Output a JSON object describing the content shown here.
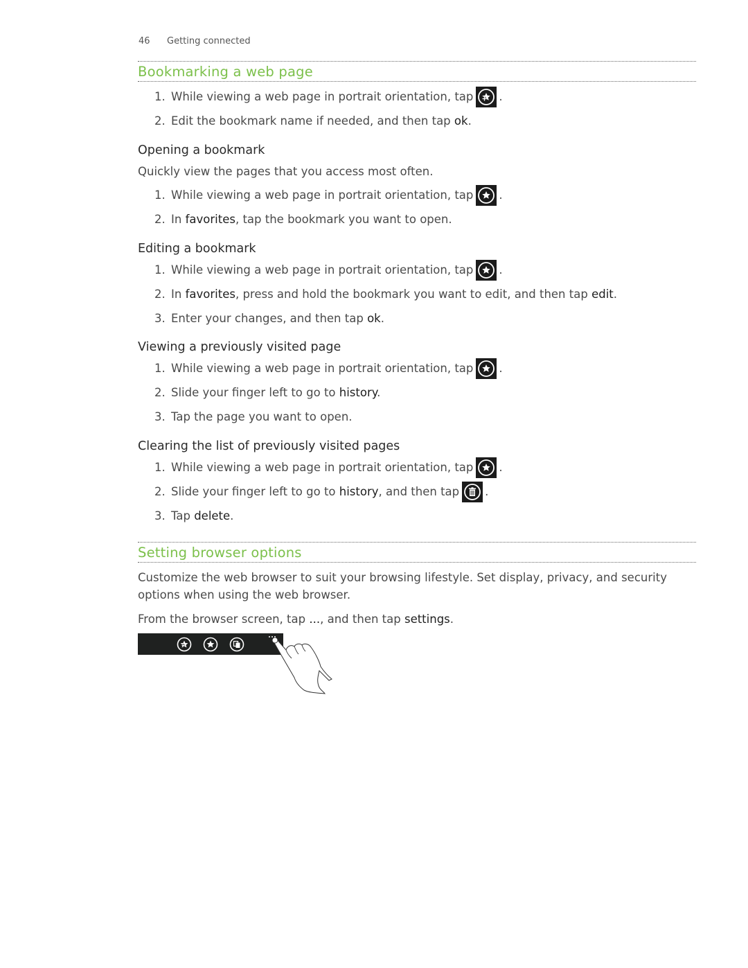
{
  "header": {
    "page_number": "46",
    "chapter": "Getting connected"
  },
  "sections": {
    "bookmarking": {
      "title": "Bookmarking a web page",
      "steps": [
        {
          "num": "1.",
          "text": "While viewing a web page in portrait orientation, tap",
          "icon": "add-favorite-icon",
          "after": "."
        },
        {
          "num": "2.",
          "pre": "Edit the bookmark name if needed, and then tap ",
          "kw": "ok",
          "after": "."
        }
      ]
    },
    "opening": {
      "title": "Opening a bookmark",
      "intro": "Quickly view the pages that you access most often.",
      "steps": [
        {
          "num": "1.",
          "text": "While viewing a web page in portrait orientation, tap",
          "icon": "favorites-icon",
          "after": "."
        },
        {
          "num": "2.",
          "pre": "In ",
          "kw": "favorites",
          "post": ", tap the bookmark you want to open."
        }
      ]
    },
    "editing": {
      "title": "Editing a bookmark",
      "steps": [
        {
          "num": "1.",
          "text": "While viewing a web page in portrait orientation, tap",
          "icon": "favorites-icon",
          "after": "."
        },
        {
          "num": "2.",
          "pre": "In ",
          "kw": "favorites",
          "mid": ", press and hold the bookmark you want to edit, and then tap ",
          "kw2": "edit",
          "after": "."
        },
        {
          "num": "3.",
          "pre": "Enter your changes, and then tap ",
          "kw": "ok",
          "after": "."
        }
      ]
    },
    "viewing": {
      "title": "Viewing a previously visited page",
      "steps": [
        {
          "num": "1.",
          "text": "While viewing a web page in portrait orientation, tap",
          "icon": "favorites-icon",
          "after": "."
        },
        {
          "num": "2.",
          "pre": "Slide your finger left to go to ",
          "kw": "history",
          "after": "."
        },
        {
          "num": "3.",
          "text": "Tap the page you want to open."
        }
      ]
    },
    "clearing": {
      "title": "Clearing the list of previously visited pages",
      "steps": [
        {
          "num": "1.",
          "text": "While viewing a web page in portrait orientation, tap",
          "icon": "favorites-icon",
          "after": "."
        },
        {
          "num": "2.",
          "pre": "Slide your finger left to go to ",
          "kw": "history",
          "post": ", and then tap",
          "icon": "delete-icon",
          "after": "."
        },
        {
          "num": "3.",
          "pre": "Tap ",
          "kw": "delete",
          "after": "."
        }
      ]
    },
    "settings": {
      "title": "Setting browser options",
      "intro": "Customize the web browser to suit your browsing lifestyle. Set display, privacy, and security options when using the web browser.",
      "instruction_pre": "From the browser screen, tap ",
      "instruction_ellipsis": "...",
      "instruction_mid": ", and then tap ",
      "instruction_kw": "settings",
      "instruction_after": ".",
      "toolbar_icons": [
        "add-favorite-icon",
        "favorites-icon",
        "tabs-icon",
        "more-icon"
      ]
    }
  },
  "colors": {
    "heading_green": "#7cc04b",
    "icon_bg": "#1b1b1b"
  }
}
